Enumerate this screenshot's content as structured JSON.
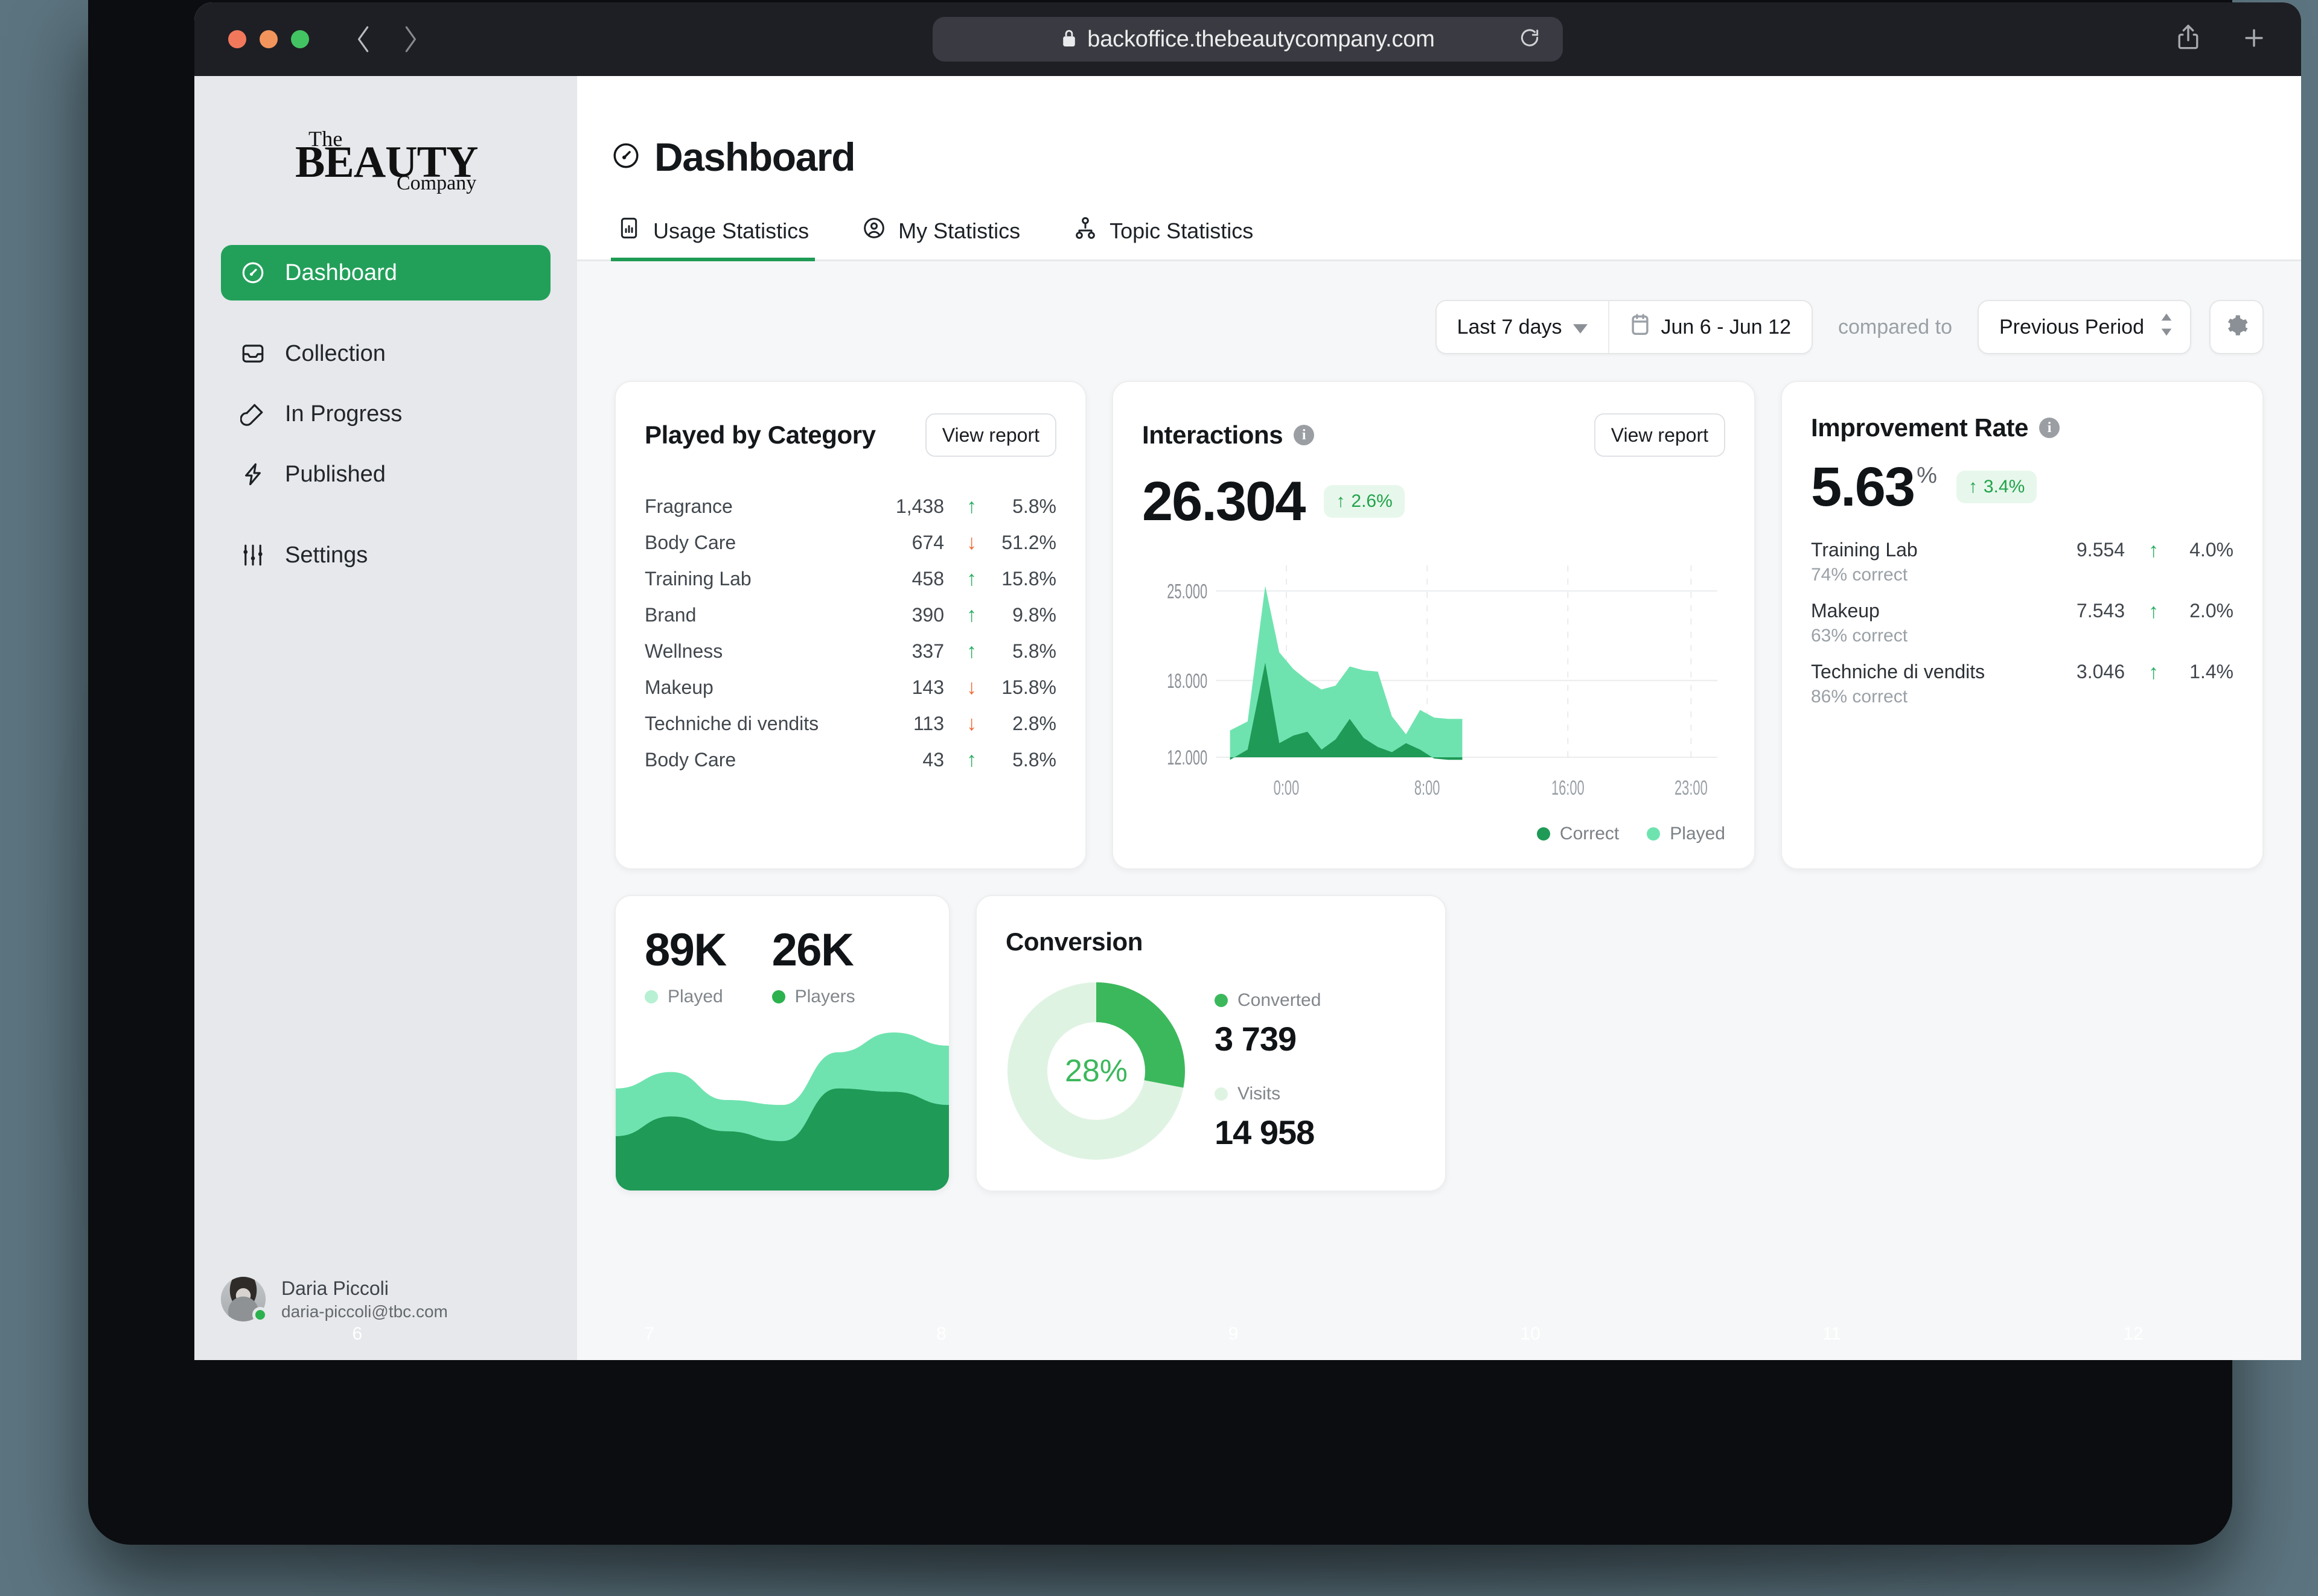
{
  "browser": {
    "url": "backoffice.thebeautycompany.com",
    "lock_icon": "lock-icon",
    "reload_icon": "reload-icon",
    "back_icon": "chevron-left-icon",
    "forward_icon": "chevron-right-icon",
    "share_icon": "share-icon",
    "new_tab_icon": "plus-icon"
  },
  "brand": {
    "line1": "The",
    "line2": "BEAUTY",
    "line3": "Company"
  },
  "sidebar": {
    "items": [
      {
        "label": "Dashboard",
        "icon": "gauge-icon",
        "active": true
      },
      {
        "label": "Collection",
        "icon": "inbox-icon",
        "active": false
      },
      {
        "label": "In Progress",
        "icon": "pencil-loop-icon",
        "active": false
      },
      {
        "label": "Published",
        "icon": "bolt-icon",
        "active": false
      },
      {
        "label": "Settings",
        "icon": "sliders-icon",
        "active": false
      }
    ],
    "user": {
      "name": "Daria Piccoli",
      "email": "daria-piccoli@tbc.com",
      "status": "online"
    }
  },
  "header": {
    "title": "Dashboard",
    "title_icon": "gauge-icon",
    "tabs": [
      {
        "label": "Usage Statistics",
        "icon": "bar-chart-device-icon",
        "active": true
      },
      {
        "label": "My Statistics",
        "icon": "user-circle-icon",
        "active": false
      },
      {
        "label": "Topic Statistics",
        "icon": "org-chart-icon",
        "active": false
      }
    ]
  },
  "toolbar": {
    "range_preset": "Last 7 days",
    "range_preset_icon": "chevron-down-icon",
    "date_range": "Jun 6 - Jun 12",
    "calendar_icon": "calendar-icon",
    "compared_to_label": "compared to",
    "comparison": "Previous Period",
    "comparison_icon": "chevron-up-down-icon",
    "settings_icon": "gear-icon"
  },
  "colors": {
    "accent_green": "#22a05a",
    "chart_dark_green": "#1f9a57",
    "chart_light_green": "#6fe3af",
    "chart_pale_green": "#e4f6e9",
    "positive": "#27ae60",
    "negative": "#f2662f",
    "chip_bg": "#e7f7ec"
  },
  "cards": {
    "played_by_category": {
      "title": "Played by Category",
      "action_label": "View report",
      "rows": [
        {
          "name": "Fragrance",
          "value": "1,438",
          "delta": "5.8%",
          "direction": "up"
        },
        {
          "name": "Body Care",
          "value": "674",
          "delta": "51.2%",
          "direction": "down"
        },
        {
          "name": "Training Lab",
          "value": "458",
          "delta": "15.8%",
          "direction": "up"
        },
        {
          "name": "Brand",
          "value": "390",
          "delta": "9.8%",
          "direction": "up"
        },
        {
          "name": "Wellness",
          "value": "337",
          "delta": "5.8%",
          "direction": "up"
        },
        {
          "name": "Makeup",
          "value": "143",
          "delta": "15.8%",
          "direction": "down"
        },
        {
          "name": "Techniche di vendits",
          "value": "113",
          "delta": "2.8%",
          "direction": "down"
        },
        {
          "name": "Body Care",
          "value": "43",
          "delta": "5.8%",
          "direction": "up"
        }
      ]
    },
    "interactions": {
      "title": "Interactions",
      "info_icon": "info-icon",
      "action_label": "View report",
      "value": "26.304",
      "delta": "2.6%",
      "delta_direction": "up",
      "legend": [
        {
          "label": "Correct",
          "color": "#1f9a57"
        },
        {
          "label": "Played",
          "color": "#6fe3af"
        }
      ]
    },
    "improvement_rate": {
      "title": "Improvement Rate",
      "info_icon": "info-icon",
      "value": "5.63",
      "unit": "%",
      "delta": "3.4%",
      "delta_direction": "up",
      "rows": [
        {
          "name": "Training Lab",
          "sub": "74% correct",
          "value": "9.554",
          "delta": "4.0%",
          "direction": "up"
        },
        {
          "name": "Makeup",
          "sub": "63% correct",
          "value": "7.543",
          "delta": "2.0%",
          "direction": "up"
        },
        {
          "name": "Techniche di vendits",
          "sub": "86% correct",
          "value": "3.046",
          "delta": "1.4%",
          "direction": "up"
        }
      ]
    },
    "mini_trend": {
      "stats": [
        {
          "value": "89K",
          "label": "Played",
          "color": "#b7f0d2"
        },
        {
          "value": "26K",
          "label": "Players",
          "color": "#2cb14f"
        }
      ]
    },
    "conversion": {
      "title": "Conversion",
      "center_label": "28%",
      "items": [
        {
          "label": "Converted",
          "value": "3 739",
          "color": "#3cb85c"
        },
        {
          "label": "Visits",
          "value": "14 958",
          "color": "#dff3e3"
        }
      ]
    }
  },
  "chart_data": [
    {
      "type": "area",
      "id": "interactions-area",
      "title": "Interactions",
      "xlabel": "",
      "ylabel": "",
      "grid": true,
      "legend_position": "bottom-right",
      "ylim": [
        12000,
        27000
      ],
      "yticks": [
        12000,
        18000,
        25000
      ],
      "ytick_labels": [
        "12.000",
        "18.000",
        "25.000"
      ],
      "xticks": [
        0,
        8,
        16,
        23
      ],
      "xtick_labels": [
        "0:00",
        "8:00",
        "16:00",
        "23:00"
      ],
      "x": [
        -3.2,
        -2.2,
        -1.2,
        -0.4,
        0.4,
        1.2,
        2.0,
        2.8,
        3.6,
        4.4,
        5.2,
        6.0,
        6.8,
        7.6,
        8.4,
        9.2,
        10.0
      ],
      "series": [
        {
          "name": "Played",
          "color": "#6fe3af",
          "values": [
            14100,
            14800,
            25400,
            20200,
            18900,
            18000,
            17300,
            17600,
            19100,
            18800,
            18700,
            15200,
            13800,
            15700,
            15100,
            15000,
            15000
          ]
        },
        {
          "name": "Correct",
          "color": "#1f9a57",
          "values": [
            11800,
            12600,
            19400,
            13100,
            13700,
            14000,
            12600,
            13400,
            15000,
            13500,
            12800,
            12400,
            13100,
            12600,
            11900,
            11800,
            11800
          ]
        }
      ]
    },
    {
      "type": "area",
      "id": "mini-trend-area",
      "title": "",
      "grid": false,
      "legend_position": "top",
      "x": [
        6,
        7,
        8,
        9,
        10,
        11,
        12
      ],
      "xtick_labels": [
        "6",
        "7",
        "8",
        "9",
        "10",
        "11",
        "12"
      ],
      "series": [
        {
          "name": "Played",
          "color": "#6fe3af",
          "values": [
            62,
            72,
            55,
            52,
            84,
            96,
            88
          ]
        },
        {
          "name": "Players",
          "color": "#1f9a57",
          "values": [
            33,
            45,
            36,
            30,
            62,
            60,
            52
          ]
        }
      ]
    },
    {
      "type": "pie",
      "id": "conversion-donut",
      "title": "Conversion",
      "labels": [
        "Converted",
        "Visits"
      ],
      "values": [
        3739,
        14958
      ],
      "percent": [
        28,
        72
      ],
      "colors": [
        "#3cb85c",
        "#dff3e3"
      ],
      "hole": 0.6,
      "center_label": "28%"
    }
  ]
}
